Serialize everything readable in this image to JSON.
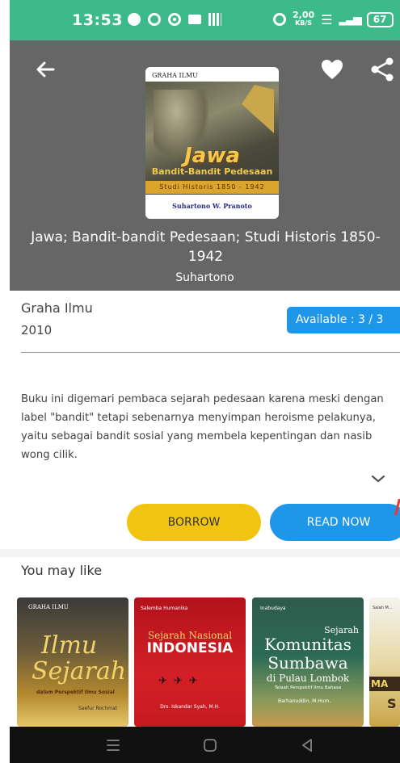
{
  "status_bar": {
    "time": "13:53",
    "speed_value": "2,00",
    "speed_unit": "KB/S",
    "battery": "67"
  },
  "book": {
    "cover": {
      "publisher": "GRAHA ILMU",
      "title": "Jawa",
      "subtitle": "Bandit-Bandit Pedesaan",
      "series": "Studi Historis 1850 - 1942",
      "author": "Suhartono W. Pranoto"
    },
    "title": "Jawa; Bandit-bandit Pedesaan; Studi Historis 1850-1942",
    "author": "Suhartono",
    "publisher": "Graha Ilmu",
    "year": "2010",
    "availability": "Available : 3 / 3",
    "description": "Buku ini digemari pembaca sejarah pedesaan karena meski dengan label \"bandit\" tetapi sebenarnya menyimpan heroisme pelakunya, yaitu sebagai bandit sosial yang membela kepentingan dan nasib wong cilik."
  },
  "actions": {
    "borrow_label": "BORROW",
    "read_label": "READ NOW"
  },
  "recommendations": {
    "heading": "You may like",
    "items": [
      {
        "publisher": "GRAHA ILMU",
        "title_line1": "Ilmu",
        "title_line2": "Sejarah",
        "subtitle": "dalam Perspektif Ilmu Sosial",
        "author": "Saefur Rochmat"
      },
      {
        "publisher": "Salemba Humanika",
        "title_line1": "Sejarah Nasional",
        "title_line2": "INDONESIA",
        "author": "Drs. Iskandar Syah, M.H."
      },
      {
        "publisher": "Inabudaya",
        "title_line1": "Sejarah",
        "title_line2": "Komunitas",
        "title_line3": "Sumbawa",
        "title_line4": "di Pulau Lombok",
        "subtitle": "Telaah Perspektif Ilmu Bahasa",
        "author": "Barhanuddin, M.Hum."
      },
      {
        "publisher": "Salah M...",
        "title_line1": "MA",
        "title_line2": "S"
      }
    ]
  },
  "colors": {
    "status_bar": "#3dba8a",
    "header": "#666666",
    "available": "#1e97e8",
    "borrow": "#f1c40f",
    "read_now": "#1e97e8"
  },
  "icons": {
    "back": "arrow-left-icon",
    "favorite": "heart-icon",
    "share": "share-icon",
    "expand": "chevron-down-icon"
  }
}
